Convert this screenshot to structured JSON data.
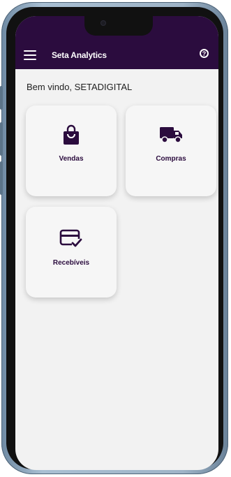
{
  "app": {
    "title": "Seta Analytics",
    "help_symbol": "?",
    "brand_color": "#2b0c3e"
  },
  "welcome": "Bem vindo, SETADIGITAL",
  "cards": [
    {
      "label": "Vendas",
      "icon": "shopping-bag-icon"
    },
    {
      "label": "Compras",
      "icon": "truck-icon"
    },
    {
      "label": "Recebíveis",
      "icon": "credit-card-check-icon"
    }
  ]
}
